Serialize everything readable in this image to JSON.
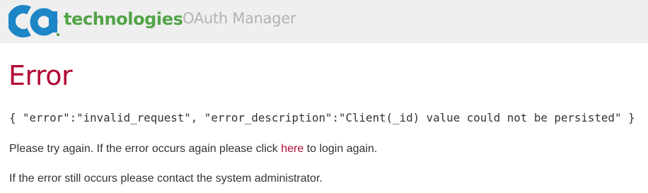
{
  "header": {
    "brand_text": "technologies",
    "app_title": "OAuth Manager",
    "colors": {
      "logo_blue": "#1d86c7",
      "brand_green": "#52a447",
      "title_gray": "#b3b3b3",
      "background": "#efefef"
    },
    "logo_icon": "ca-logo"
  },
  "main": {
    "title": "Error",
    "title_color": "#b30a36",
    "error_json": "{ \"error\":\"invalid_request\", \"error_description\":\"Client(_id) value could not be persisted\" }",
    "retry_message": {
      "prefix": "Please try again. If the error occurs again please click ",
      "link_label": "here",
      "suffix": " to login again."
    },
    "contact_message": "If the error still occurs please contact the system administrator."
  }
}
